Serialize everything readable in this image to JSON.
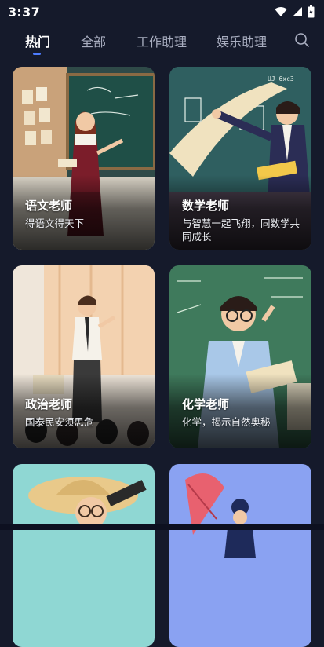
{
  "status_bar": {
    "time": "3:37"
  },
  "tabs": [
    {
      "label": "热门",
      "active": true
    },
    {
      "label": "全部",
      "active": false
    },
    {
      "label": "工作助理",
      "active": false
    },
    {
      "label": "娱乐助理",
      "active": false
    }
  ],
  "cards": [
    {
      "title": "语文老师",
      "desc": "得语文得天下"
    },
    {
      "title": "数学老师",
      "desc": "与智慧一起飞翔，同数学共同成长"
    },
    {
      "title": "政治老师",
      "desc": "国泰民安须思危"
    },
    {
      "title": "化学老师",
      "desc": "化学，揭示自然奥秘"
    }
  ],
  "colors": {
    "background": "#151a2b",
    "accent": "#4d7cff",
    "tab_inactive": "#a9aec0"
  },
  "icons": {
    "search": "search-icon",
    "wifi": "wifi-icon",
    "signal": "signal-icon",
    "battery": "battery-icon"
  }
}
